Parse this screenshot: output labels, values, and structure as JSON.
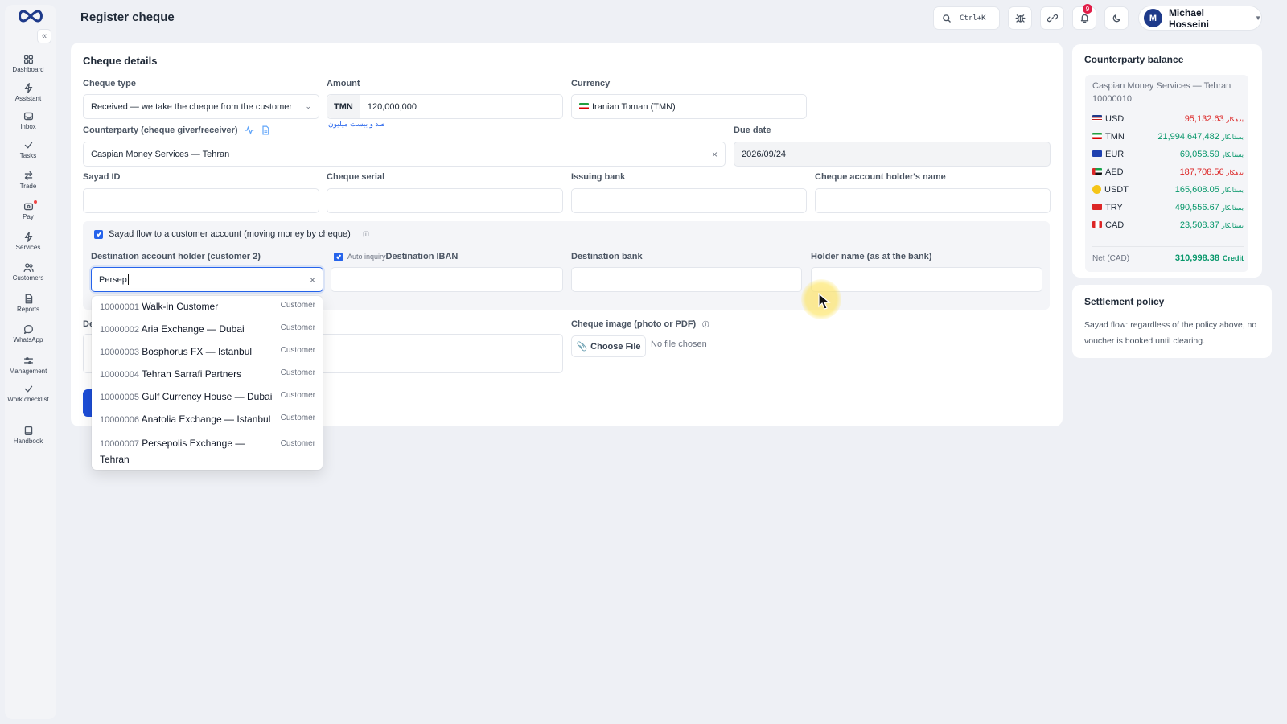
{
  "sidebar": {
    "items": [
      {
        "label": "Dashboard",
        "icon": "dashboard-icon"
      },
      {
        "label": "Assistant",
        "icon": "lightning-icon"
      },
      {
        "label": "Inbox",
        "icon": "inbox-icon"
      },
      {
        "label": "Tasks",
        "icon": "check-icon"
      },
      {
        "label": "Trade",
        "icon": "swap-icon"
      },
      {
        "label": "Pay",
        "icon": "wallet-icon"
      },
      {
        "label": "Services",
        "icon": "lightning-icon"
      },
      {
        "label": "Customers",
        "icon": "users-icon"
      },
      {
        "label": "Reports",
        "icon": "document-icon"
      },
      {
        "label": "WhatsApp",
        "icon": "chat-icon"
      },
      {
        "label": "Management",
        "icon": "sliders-icon"
      },
      {
        "label": "Work checklist",
        "icon": "check-icon"
      },
      {
        "label": "Handbook",
        "icon": "book-icon"
      }
    ],
    "collapse_label": "«"
  },
  "header": {
    "title": "Register cheque",
    "search_shortcut": "Ctrl+K",
    "notification_count": "9",
    "user_initial": "M",
    "user_name": "Michael Hosseini"
  },
  "form": {
    "title": "Cheque details",
    "cheque_type": {
      "label": "Cheque type",
      "value": "Received — we take the cheque from the customer"
    },
    "amount": {
      "label": "Amount",
      "currency_tag": "TMN",
      "value": "120,000,000",
      "words": "صد و بیست میلیون"
    },
    "currency": {
      "label": "Currency",
      "value": "Iranian Toman (TMN)"
    },
    "counterparty": {
      "label": "Counterparty (cheque giver/receiver)",
      "value": "Caspian Money Services — Tehran"
    },
    "due_date": {
      "label": "Due date",
      "value": "2026/09/24"
    },
    "sayad_id": {
      "label": "Sayad ID",
      "value": ""
    },
    "cheque_serial": {
      "label": "Cheque serial",
      "value": ""
    },
    "issuing_bank": {
      "label": "Issuing bank",
      "value": ""
    },
    "account_holder": {
      "label": "Cheque account holder's name",
      "value": ""
    },
    "sayad_flow": {
      "label": "Sayad flow to a customer account (moving money by cheque)",
      "checked": true
    },
    "dest_holder": {
      "label": "Destination account holder (customer 2)",
      "value": "Persep"
    },
    "auto_inquiry": {
      "label": "Auto inquiry",
      "checked": true
    },
    "dest_iban": {
      "label": "Destination IBAN",
      "value": ""
    },
    "dest_bank": {
      "label": "Destination bank",
      "value": ""
    },
    "holder_name": {
      "label": "Holder name (as at the bank)",
      "value": ""
    },
    "description_partial": "De",
    "cheque_image": {
      "label": "Cheque image (photo or PDF)",
      "button": "Choose File",
      "status": "No file chosen"
    }
  },
  "dropdown": {
    "items": [
      {
        "code": "10000001",
        "name": "Walk-in Customer",
        "type": "Customer"
      },
      {
        "code": "10000002",
        "name": "Aria Exchange — Dubai",
        "type": "Customer"
      },
      {
        "code": "10000003",
        "name": "Bosphorus FX — Istanbul",
        "type": "Customer"
      },
      {
        "code": "10000004",
        "name": "Tehran Sarrafi Partners",
        "type": "Customer"
      },
      {
        "code": "10000005",
        "name": "Gulf Currency House — Dubai",
        "type": "Customer"
      },
      {
        "code": "10000006",
        "name": "Anatolia Exchange — Istanbul",
        "type": "Customer"
      },
      {
        "code": "10000007",
        "name": "Persepolis Exchange —",
        "name2": "Tehran",
        "type": "Customer"
      }
    ]
  },
  "balance": {
    "title": "Counterparty balance",
    "party": "Caspian Money Services — Tehran",
    "party_code": "10000010",
    "rows": [
      {
        "cur": "USD",
        "value": "95,132.63",
        "tag": "بدهکار",
        "status": "debit"
      },
      {
        "cur": "TMN",
        "value": "21,994,647,482",
        "tag": "بستانکار",
        "status": "credit"
      },
      {
        "cur": "EUR",
        "value": "69,058.59",
        "tag": "بستانکار",
        "status": "credit"
      },
      {
        "cur": "AED",
        "value": "187,708.56",
        "tag": "بدهکار",
        "status": "debit"
      },
      {
        "cur": "USDT",
        "value": "165,608.05",
        "tag": "بستانکار",
        "status": "credit"
      },
      {
        "cur": "TRY",
        "value": "490,556.67",
        "tag": "بستانکار",
        "status": "credit"
      },
      {
        "cur": "CAD",
        "value": "23,508.37",
        "tag": "بستانکار",
        "status": "credit"
      }
    ],
    "net_label": "Net (CAD)",
    "net_value": "310,998.38",
    "net_tag": "Credit"
  },
  "policy": {
    "title": "Settlement policy",
    "text": "Sayad flow: regardless of the policy above, no voucher is booked until clearing."
  },
  "colors": {
    "accent": "#2563eb",
    "debit": "#dc2626",
    "credit": "#059669"
  }
}
